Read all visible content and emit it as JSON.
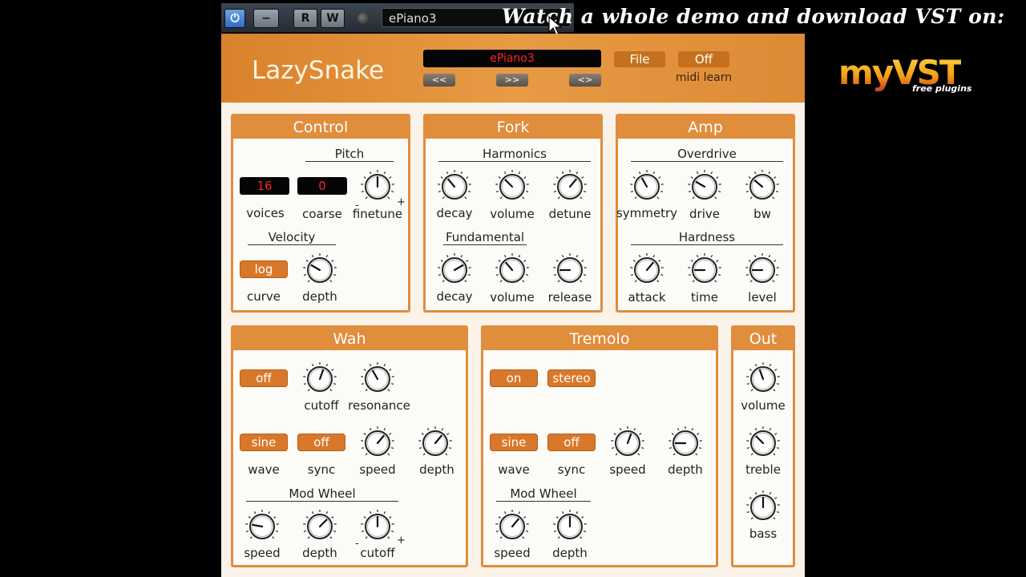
{
  "host": {
    "r_label": "R",
    "w_label": "W",
    "preset": "ePiano3",
    "minus_label": "−"
  },
  "overlay": {
    "watch_text": "Watch a whole demo and download VST on:",
    "logo_main": "myVST",
    "logo_sub": "free plugins"
  },
  "plugin": {
    "title": "LazySnake",
    "patch": "ePiano3",
    "nav_prev": "<<",
    "nav_next": ">>",
    "nav_swap": "<>",
    "file": "File",
    "midi_learn_value": "Off",
    "midi_learn_label": "midi learn"
  },
  "control": {
    "title": "Control",
    "pitch": "Pitch",
    "voices_value": "16",
    "coarse_value": "0",
    "voices": "voices",
    "coarse": "coarse",
    "finetune": "finetune",
    "velocity": "Velocity",
    "curve_value": "log",
    "curve": "curve",
    "depth": "depth",
    "minus": "-",
    "plus": "+"
  },
  "fork": {
    "title": "Fork",
    "harmonics": "Harmonics",
    "fundamental": "Fundamental",
    "decay": "decay",
    "volume": "volume",
    "detune": "detune",
    "release": "release"
  },
  "amp": {
    "title": "Amp",
    "overdrive": "Overdrive",
    "symmetry": "symmetry",
    "drive": "drive",
    "bw": "bw",
    "hardness": "Hardness",
    "attack": "attack",
    "time": "time",
    "level": "level"
  },
  "wah": {
    "title": "Wah",
    "onoff_value": "off",
    "cutoff": "cutoff",
    "resonance": "resonance",
    "wave_value": "sine",
    "sync_value": "off",
    "wave": "wave",
    "sync": "sync",
    "speed": "speed",
    "depth": "depth",
    "mod_wheel": "Mod Wheel",
    "mw_speed": "speed",
    "mw_depth": "depth",
    "mw_cutoff": "cutoff",
    "minus": "-",
    "plus": "+"
  },
  "tremolo": {
    "title": "Tremolo",
    "onoff_value": "on",
    "stereo_value": "stereo",
    "wave_value": "sine",
    "sync_value": "off",
    "wave": "wave",
    "sync": "sync",
    "speed": "speed",
    "depth": "depth",
    "mod_wheel": "Mod Wheel",
    "mw_speed": "speed",
    "mw_depth": "depth"
  },
  "out": {
    "title": "Out",
    "volume": "volume",
    "treble": "treble",
    "bass": "bass"
  },
  "knob_angles": {
    "finetune": 0,
    "vel_depth": -60,
    "h_decay": -40,
    "h_volume": -45,
    "h_detune": 40,
    "f_decay": 60,
    "f_volume": -40,
    "f_release": -90,
    "symmetry": -30,
    "drive": -60,
    "bw": -50,
    "attack": 40,
    "time": -90,
    "level": -90,
    "wah_cutoff": 20,
    "wah_res": -30,
    "wah_speed": 40,
    "wah_depth": 40,
    "wmw_speed": -80,
    "wmw_depth": 45,
    "wmw_cutoff": 0,
    "tr_speed": 20,
    "tr_depth": -90,
    "tmw_speed": 40,
    "tmw_depth": 0,
    "out_volume": -20,
    "out_treble": -45,
    "out_bass": 0
  }
}
